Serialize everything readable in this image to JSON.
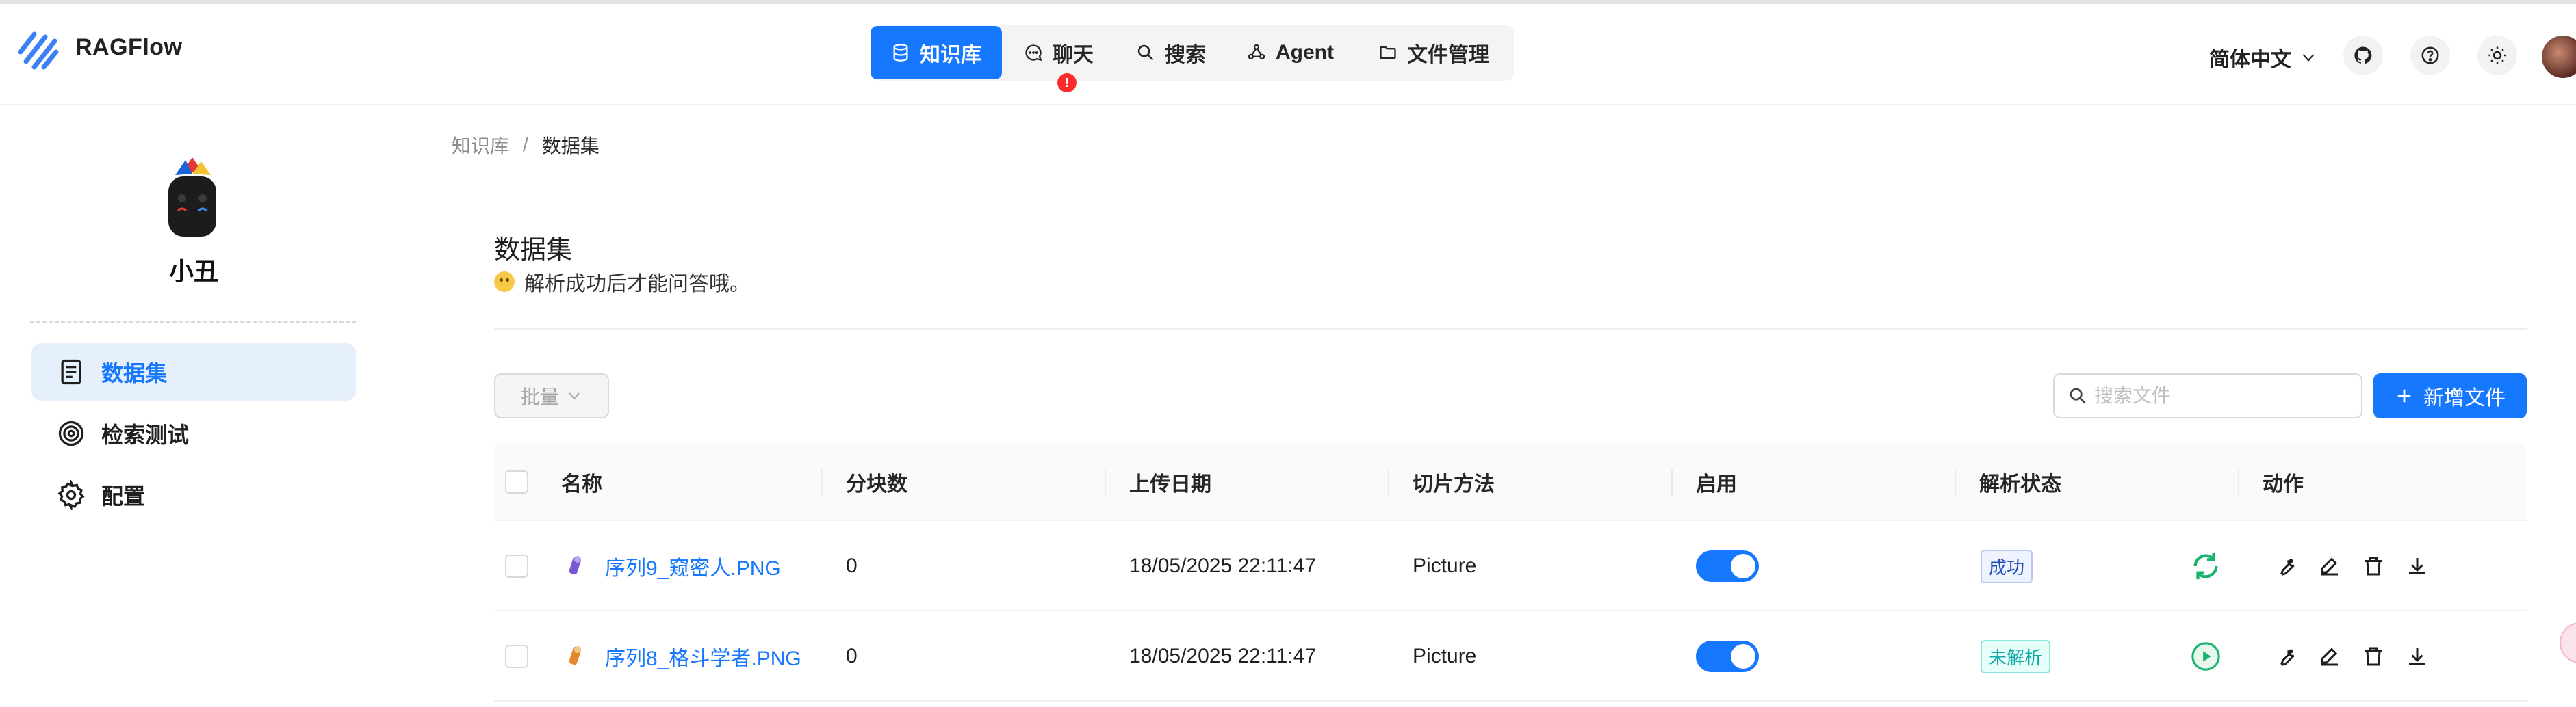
{
  "app": {
    "name": "RAGFlow"
  },
  "nav": {
    "items": [
      {
        "label": "知识库",
        "icon": "database-icon",
        "active": true
      },
      {
        "label": "聊天",
        "icon": "chat-icon",
        "badge": "!"
      },
      {
        "label": "搜索",
        "icon": "search-icon"
      },
      {
        "label": "Agent",
        "icon": "agent-graph-icon"
      },
      {
        "label": "文件管理",
        "icon": "folder-icon"
      }
    ]
  },
  "header": {
    "language": "简体中文",
    "icons": [
      "github-icon",
      "help-icon",
      "theme-sun-icon",
      "user-avatar"
    ]
  },
  "sidebar": {
    "kb_name": "小丑",
    "items": [
      {
        "label": "数据集",
        "icon": "dataset-icon",
        "active": true
      },
      {
        "label": "检索测试",
        "icon": "retrieval-test-icon"
      },
      {
        "label": "配置",
        "icon": "settings-gear-icon"
      }
    ]
  },
  "breadcrumb": {
    "parent": "知识库",
    "separator": "/",
    "current": "数据集"
  },
  "page": {
    "title": "数据集",
    "description": "解析成功后才能问答哦。"
  },
  "toolbar": {
    "bulk_label": "批量",
    "search_placeholder": "搜索文件",
    "add_label": "新增文件"
  },
  "table": {
    "columns": [
      "名称",
      "分块数",
      "上传日期",
      "切片方法",
      "启用",
      "解析状态",
      "动作"
    ],
    "rows": [
      {
        "name": "序列9_窥密人.PNG",
        "chunks": "0",
        "upload_date": "18/05/2025 22:11:47",
        "method": "Picture",
        "enabled": true,
        "status": "成功",
        "status_type": "success",
        "status_action": "refresh-icon"
      },
      {
        "name": "序列8_格斗学者.PNG",
        "chunks": "0",
        "upload_date": "18/05/2025 22:11:47",
        "method": "Picture",
        "enabled": true,
        "status": "未解析",
        "status_type": "unparsed",
        "status_action": "play-icon"
      }
    ]
  },
  "colors": {
    "primary": "#1677ff",
    "active_bg": "#e6f0fc",
    "success_green": "#18b46b",
    "badge_red": "#ff2a2a"
  }
}
